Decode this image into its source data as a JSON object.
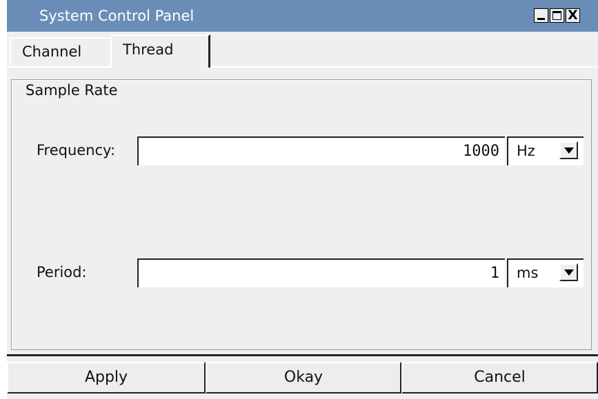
{
  "window": {
    "title": "System Control Panel",
    "controls": {
      "minimize": "minimize-icon",
      "maximize": "maximize-icon",
      "close_label": "X"
    }
  },
  "tabs": [
    {
      "label": "Channel",
      "active": false
    },
    {
      "label": "Thread",
      "active": true
    }
  ],
  "sample_rate": {
    "group_title": "Sample Rate",
    "frequency": {
      "label": "Frequency:",
      "value": "1000",
      "unit": "Hz"
    },
    "period": {
      "label": "Period:",
      "value": "1",
      "unit": "ms"
    }
  },
  "buttons": {
    "apply": "Apply",
    "okay": "Okay",
    "cancel": "Cancel"
  },
  "colors": {
    "titlebar": "#6a8db8",
    "background": "#efefef"
  }
}
